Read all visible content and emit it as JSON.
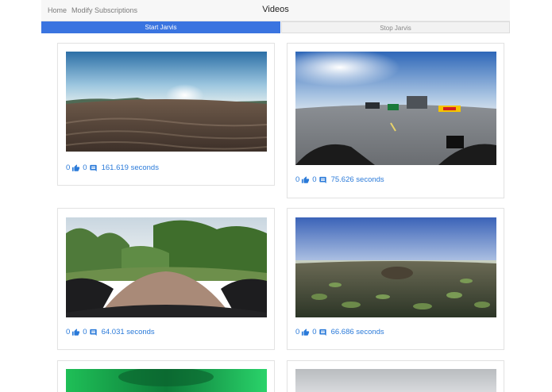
{
  "navbar": {
    "links": [
      "Home",
      "Modify Subscriptions"
    ],
    "title": "Videos"
  },
  "controls": {
    "start_label": "Start Jarvis",
    "stop_label": "Stop Jarvis"
  },
  "colors": {
    "accent": "#3a74e0",
    "stat_text": "#2a7ad9"
  },
  "videos": [
    {
      "likes": "0",
      "comments": "0",
      "duration": "161.619 seconds",
      "thumbnail": "beach-panorama"
    },
    {
      "likes": "0",
      "comments": "0",
      "duration": "75.626 seconds",
      "thumbnail": "road-panorama"
    },
    {
      "likes": "0",
      "comments": "0",
      "duration": "64.031 seconds",
      "thumbnail": "forest-path-panorama"
    },
    {
      "likes": "0",
      "comments": "0",
      "duration": "66.686 seconds",
      "thumbnail": "lily-pond-panorama"
    },
    {
      "thumbnail": "green-panorama"
    },
    {
      "thumbnail": "grey-panorama"
    }
  ]
}
